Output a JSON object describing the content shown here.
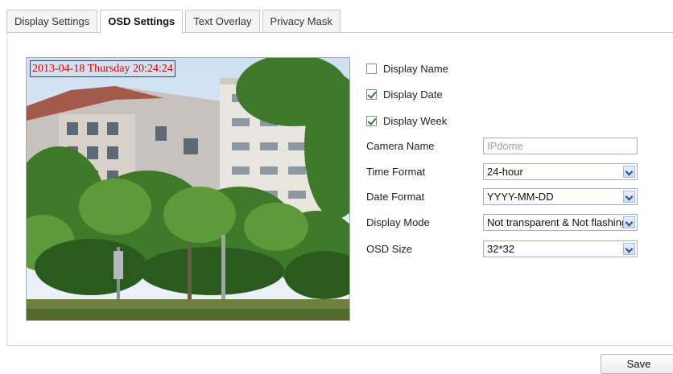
{
  "tabs": [
    {
      "label": "Display Settings",
      "active": false
    },
    {
      "label": "OSD Settings",
      "active": true
    },
    {
      "label": "Text Overlay",
      "active": false
    },
    {
      "label": "Privacy Mask",
      "active": false
    }
  ],
  "preview": {
    "osd_text": "2013-04-18 Thursday 20:24:24"
  },
  "options": {
    "display_name": {
      "label": "Display Name",
      "checked": false
    },
    "display_date": {
      "label": "Display Date",
      "checked": true
    },
    "display_week": {
      "label": "Display Week",
      "checked": true
    }
  },
  "form": {
    "camera_name": {
      "label": "Camera Name",
      "value": "IPdome"
    },
    "time_format": {
      "label": "Time Format",
      "value": "24-hour"
    },
    "date_format": {
      "label": "Date Format",
      "value": "YYYY-MM-DD"
    },
    "display_mode": {
      "label": "Display Mode",
      "value": "Not transparent & Not flashing"
    },
    "osd_size": {
      "label": "OSD Size",
      "value": "32*32"
    }
  },
  "save_label": "Save",
  "colors": {
    "osd_text": "#d00000",
    "checkmark": "#2f7d2f",
    "field_border": "#9fb1c6"
  },
  "icons": {
    "dropdown": "chevron-down-icon",
    "checkbox": "checkbox-icon"
  }
}
